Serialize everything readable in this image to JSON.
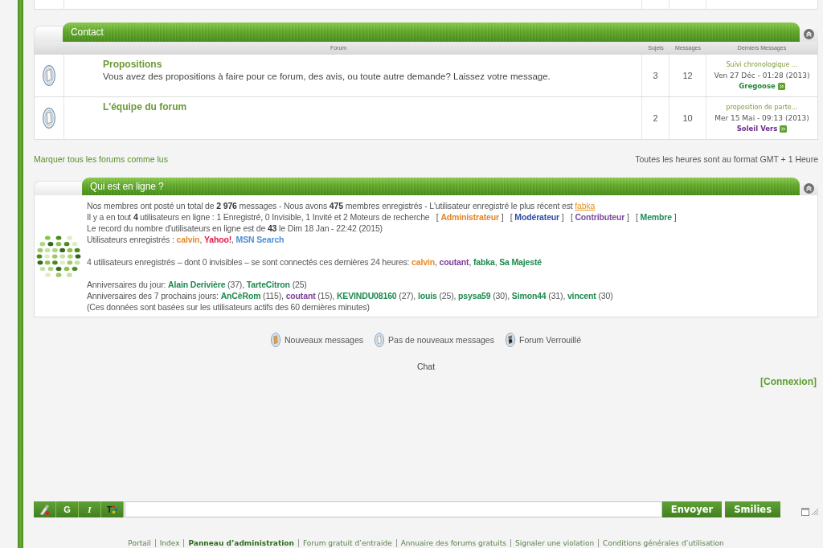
{
  "contact": {
    "title": "Contact",
    "expanded": true,
    "columns": [
      "Forum",
      "Sujets",
      "Messages",
      "Derniers Messages"
    ],
    "rows": [
      {
        "kind": "no_new",
        "title": "Propositions",
        "description": "Vous avez des propositions à faire pour ce forum, des avis, ou toute autre demande? Laissez votre message.",
        "topics": "3",
        "posts": "12",
        "last_post": {
          "subject": "Suivi chronologique ...",
          "date": "Ven 27 Déc - 01:28 (2013)",
          "author": "Gregoose",
          "color": "#23883a"
        }
      },
      {
        "kind": "no_new",
        "title": "L'équipe du forum",
        "topics": "2",
        "posts": "10",
        "last_post": {
          "subject": "proposition de parte...",
          "date": "Mer 15 Mai - 09:13 (2013)",
          "author": "Soleil Vers",
          "color": "#6b2d8a"
        }
      }
    ]
  },
  "mark_all_read": "Marquer tous les forums comme lus",
  "timezone_note": "Toutes les heures sont au format GMT + 1 Heure",
  "who_is_online": {
    "title": "Qui est en ligne ?",
    "expanded": true,
    "blocks": [
      {
        "lines": [
          {
            "parts": [
              {
                "kind": "text",
                "text": "Nos membres ont posté un total de "
              },
              {
                "kind": "strong",
                "text": "2 976"
              },
              {
                "kind": "text",
                "text": " messages - Nous avons "
              },
              {
                "kind": "strong",
                "text": "475"
              },
              {
                "kind": "text",
                "text": " membres enregistrés - L'utilisateur enregistré le plus récent est "
              },
              {
                "kind": "link",
                "text": "fabka",
                "color": "#e0952a"
              }
            ]
          },
          {
            "parts": [
              {
                "kind": "text",
                "text": "Il y a en tout "
              },
              {
                "kind": "strong",
                "text": "4"
              },
              {
                "kind": "text",
                "text": " utilisateurs en ligne : 1 Enregistré, 0 Invisible, 1 Invité et 2 Moteurs de recherche   [ "
              },
              {
                "kind": "group",
                "text": "Administrateur",
                "color": "#e0862a"
              },
              {
                "kind": "text",
                "text": " ]   [ "
              },
              {
                "kind": "group",
                "text": "Modérateur",
                "color": "#2f4fa8"
              },
              {
                "kind": "text",
                "text": " ]   [ "
              },
              {
                "kind": "group",
                "text": "Contributeur",
                "color": "#7b4a9e"
              },
              {
                "kind": "text",
                "text": " ]   [ "
              },
              {
                "kind": "group",
                "text": "Membre",
                "color": "#1d8a5a"
              },
              {
                "kind": "text",
                "text": " ]"
              }
            ]
          },
          {
            "parts": [
              {
                "kind": "text",
                "text": "Le record du nombre d'utilisateurs en ligne est de "
              },
              {
                "kind": "strong",
                "text": "43"
              },
              {
                "kind": "text",
                "text": " le Dim 18 Jan - 22:42 (2015)"
              }
            ]
          },
          {
            "parts": [
              {
                "kind": "text",
                "text": "Utilisateurs enregistrés : "
              },
              {
                "kind": "user",
                "text": "calvin",
                "color": "#e8892a"
              },
              {
                "kind": "text",
                "text": ", "
              },
              {
                "kind": "user",
                "text": "Yahoo!",
                "color": "#e3194b"
              },
              {
                "kind": "text",
                "text": ", "
              },
              {
                "kind": "user",
                "text": "MSN Search",
                "color": "#4f8fd6"
              }
            ]
          }
        ]
      },
      {
        "lines": [
          {
            "parts": [
              {
                "kind": "text",
                "text": "4 utilisateurs enregistrés – dont 0 invisibles – se sont connectés ces dernières 24 heures: "
              },
              {
                "kind": "user",
                "text": "calvin",
                "color": "#e8892a"
              },
              {
                "kind": "text",
                "text": ", "
              },
              {
                "kind": "user",
                "text": "coutant",
                "color": "#7b3f98"
              },
              {
                "kind": "text",
                "text": ", "
              },
              {
                "kind": "user",
                "text": "fabka",
                "color": "#1d8a4e"
              },
              {
                "kind": "text",
                "text": ", "
              },
              {
                "kind": "user",
                "text": "Sa Majesté",
                "color": "#1d8a4e"
              }
            ]
          }
        ]
      },
      {
        "lines": [
          {
            "parts": [
              {
                "kind": "text",
                "text": "Anniversaires du jour: "
              },
              {
                "kind": "user",
                "text": "Alain Derivière",
                "color": "#1d8a4e"
              },
              {
                "kind": "text",
                "text": " (37), "
              },
              {
                "kind": "user",
                "text": "TarteCitron",
                "color": "#1d8a4e"
              },
              {
                "kind": "text",
                "text": " (25)"
              }
            ]
          },
          {
            "parts": [
              {
                "kind": "text",
                "text": "Anniversaires des 7 prochains jours: "
              },
              {
                "kind": "user",
                "text": "AnCèRom",
                "color": "#1d8a4e"
              },
              {
                "kind": "text",
                "text": " (115), "
              },
              {
                "kind": "user",
                "text": "coutant",
                "color": "#7b3f98"
              },
              {
                "kind": "text",
                "text": " (15), "
              },
              {
                "kind": "user",
                "text": "KEVINDU08160",
                "color": "#1d8a4e"
              },
              {
                "kind": "text",
                "text": " (27), "
              },
              {
                "kind": "user",
                "text": "louis",
                "color": "#1d8a4e"
              },
              {
                "kind": "text",
                "text": " (25), "
              },
              {
                "kind": "user",
                "text": "psysa59",
                "color": "#1d8a4e"
              },
              {
                "kind": "text",
                "text": " (30), "
              },
              {
                "kind": "user",
                "text": "Simon44",
                "color": "#1d8a4e"
              },
              {
                "kind": "text",
                "text": " (31), "
              },
              {
                "kind": "user",
                "text": "vincent",
                "color": "#1d8a4e"
              },
              {
                "kind": "text",
                "text": " (30)"
              }
            ]
          },
          {
            "parts": [
              {
                "kind": "text",
                "text": "(Ces données sont basées sur les utilisateurs actifs des 60 dernières minutes)"
              }
            ]
          }
        ]
      }
    ]
  },
  "legend": [
    {
      "kind": "new",
      "label": "Nouveaux messages"
    },
    {
      "kind": "no_new",
      "label": "Pas de nouveaux messages"
    },
    {
      "kind": "locked",
      "label": "Forum Verrouillé"
    }
  ],
  "chat": {
    "title": "Chat",
    "login_link": "[Connexion]",
    "toolbar": [
      {
        "kind": "brush"
      },
      {
        "kind": "bold",
        "label": "G"
      },
      {
        "kind": "italic",
        "label": "I"
      },
      {
        "kind": "text_color",
        "label": "T"
      }
    ],
    "buttons": [
      "Envoyer",
      "Smilies"
    ]
  },
  "footer": {
    "links": [
      {
        "label": "Portail",
        "bold": false
      },
      {
        "label": "Index",
        "bold": false
      },
      {
        "label": "Panneau d’administration",
        "bold": true
      },
      {
        "label": "Forum gratuit d’entraide",
        "bold": false
      },
      {
        "label": "Annuaire des forums gratuits",
        "bold": false
      },
      {
        "label": "Signaler une violation",
        "bold": false
      },
      {
        "label": "Conditions générales d’utilisation",
        "bold": false
      }
    ]
  }
}
